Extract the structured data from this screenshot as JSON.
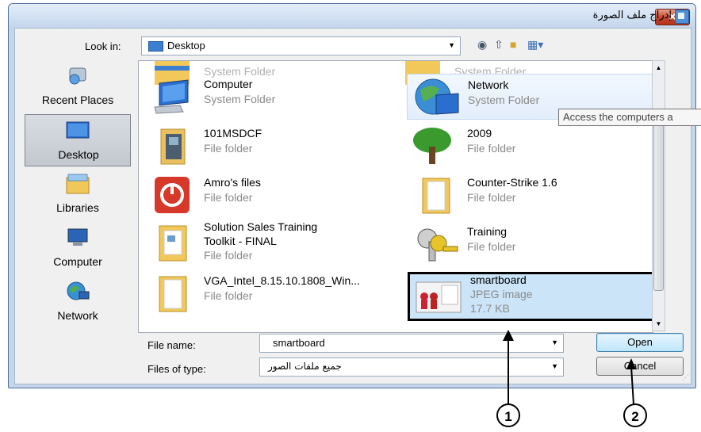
{
  "window": {
    "title": "إدراج ملف الصورة",
    "close_label": "✕"
  },
  "toolbar": {
    "look_in_label": "Look in:",
    "look_in_value": "Desktop",
    "back_icon": "back-arrow-icon",
    "up_icon": "up-folder-icon",
    "new_folder_icon": "new-folder-icon",
    "views_icon": "views-menu-icon"
  },
  "places": [
    {
      "label": "Recent Places",
      "icon": "recent-places-icon"
    },
    {
      "label": "Desktop",
      "icon": "desktop-icon",
      "selected": true
    },
    {
      "label": "Libraries",
      "icon": "libraries-icon"
    },
    {
      "label": "Computer",
      "icon": "computer-icon"
    },
    {
      "label": "Network",
      "icon": "network-icon"
    }
  ],
  "files": {
    "partial_top": [
      "System Folder",
      "System Folder"
    ],
    "items": [
      {
        "name": "Computer",
        "type": "System Folder"
      },
      {
        "name": "Network",
        "type": "System Folder"
      },
      {
        "name": "101MSDCF",
        "type": "File folder"
      },
      {
        "name": "2009",
        "type": "File folder"
      },
      {
        "name": "Amro's files",
        "type": "File folder"
      },
      {
        "name": "Counter-Strike 1.6",
        "type": "File folder"
      },
      {
        "name_line1": "Solution Sales Training",
        "name_line2": "Toolkit - FINAL",
        "type": "File folder"
      },
      {
        "name": "Training",
        "type": "File folder"
      },
      {
        "name": "VGA_Intel_8.15.10.1808_Win...",
        "type": "File folder"
      },
      {
        "name": "smartboard",
        "type": "JPEG image",
        "size": "17.7 KB",
        "selected": true
      }
    ],
    "tooltip": "Access the computers a"
  },
  "footer": {
    "file_name_label": "File name:",
    "file_name_value": "smartboard",
    "file_type_label": "Files of type:",
    "file_type_value": "جميع ملفات الصور",
    "open_label": "Open",
    "cancel_label": "Cancel"
  },
  "callouts": [
    "1",
    "2"
  ]
}
